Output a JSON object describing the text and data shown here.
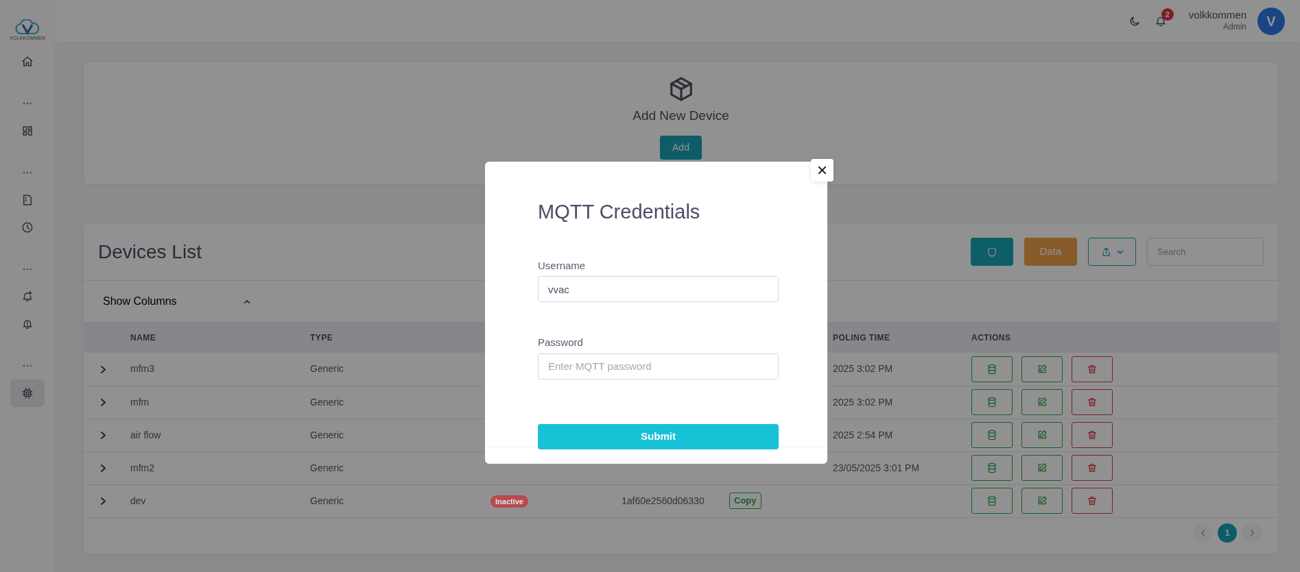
{
  "sidebar": {
    "logo_text": "VOLKKOMMEN",
    "items": [
      {
        "kind": "link",
        "selected": false
      },
      {
        "kind": "separator"
      },
      {
        "kind": "link",
        "selected": false
      },
      {
        "kind": "separator"
      },
      {
        "kind": "link",
        "selected": false
      },
      {
        "kind": "link",
        "selected": false
      },
      {
        "kind": "separator"
      },
      {
        "kind": "link",
        "selected": false
      },
      {
        "kind": "link",
        "selected": false
      },
      {
        "kind": "separator"
      },
      {
        "kind": "link",
        "selected": true
      }
    ]
  },
  "header": {
    "notification_count": "2",
    "user_name": "volkkommen",
    "user_role": "Admin",
    "avatar_letter": "V"
  },
  "add_card": {
    "title": "Add New Device",
    "button": "Add"
  },
  "devices": {
    "title": "Devices List",
    "data_button": "Data",
    "search_placeholder": "Search",
    "show_columns": {
      "label": "Show Columns",
      "expanded": true
    },
    "columns": {
      "name": "NAME",
      "type": "TYPE",
      "polling_time": "POLING TIME",
      "actions": "ACTIONS"
    },
    "rows": [
      {
        "name": "mfm3",
        "type": "Generic",
        "polling_time": "2025 3:02 PM"
      },
      {
        "name": "mfm",
        "type": "Generic",
        "polling_time": "2025 3:02 PM"
      },
      {
        "name": "air flow",
        "type": "Generic",
        "polling_time": "2025 2:54 PM"
      },
      {
        "name": "mfm2",
        "type": "Generic",
        "polling_time": "23/05/2025 3:01 PM"
      },
      {
        "name": "dev",
        "type": "Generic",
        "status": {
          "label": "Inactive",
          "color": "#b84a4f"
        },
        "device_id": "1af60e2560d06330",
        "copy_button": "Copy"
      }
    ],
    "pagination": {
      "prev_disabled": true,
      "next_disabled": true,
      "pages": [
        {
          "label": "1",
          "selected": true
        }
      ]
    }
  },
  "modal": {
    "title": "MQTT Credentials",
    "fields": [
      {
        "label": "Username",
        "value": "vvac"
      },
      {
        "label": "Password",
        "placeholder": "Enter MQTT password"
      }
    ],
    "submit": "Submit"
  }
}
